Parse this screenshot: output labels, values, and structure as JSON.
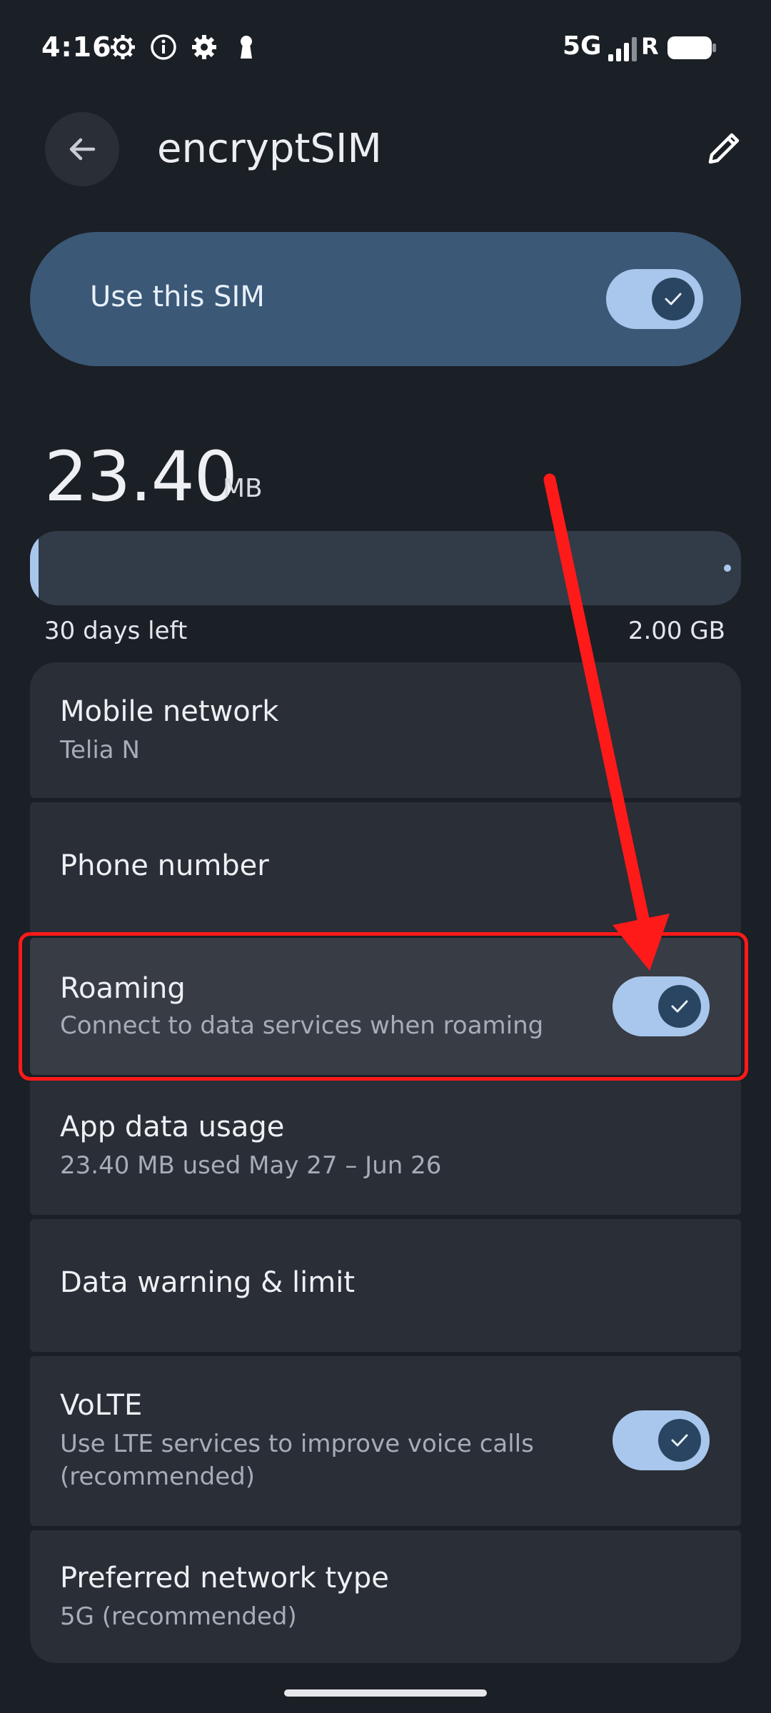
{
  "status_bar": {
    "time": "4:16",
    "icons": [
      "settings-gear-icon",
      "info-icon",
      "gear-icon",
      "keyhole-icon"
    ],
    "network": "5G",
    "roaming_indicator": "R",
    "battery_icon": "battery-full-icon"
  },
  "app_bar": {
    "title": "encryptSIM",
    "back_icon": "arrow-back-icon",
    "edit_icon": "pencil-icon"
  },
  "use_sim": {
    "label": "Use this SIM",
    "enabled": true
  },
  "usage": {
    "amount": "23.40",
    "unit": "MB",
    "days_left": "30 days left",
    "limit": "2.00 GB",
    "used_fraction": 0.0117
  },
  "settings": {
    "mobile_network": {
      "title": "Mobile network",
      "subtitle": "Telia N"
    },
    "phone_number": {
      "title": "Phone number"
    },
    "roaming": {
      "title": "Roaming",
      "subtitle": "Connect to data services when roaming",
      "enabled": true
    },
    "app_data_usage": {
      "title": "App data usage",
      "subtitle": "23.40 MB used May 27 – Jun 26"
    },
    "data_warning": {
      "title": "Data warning & limit"
    },
    "volte": {
      "title": "VoLTE",
      "subtitle_line1": "Use LTE services to improve voice calls",
      "subtitle_line2": "(recommended)",
      "enabled": true
    },
    "preferred_network": {
      "title": "Preferred network type",
      "subtitle": "5G (recommended)"
    }
  },
  "colors": {
    "background": "#1b1f26",
    "card": "#2a2e36",
    "accent": "#a9c7ec",
    "sim_card": "#3b5876",
    "annotation": "#ff1a1a"
  }
}
